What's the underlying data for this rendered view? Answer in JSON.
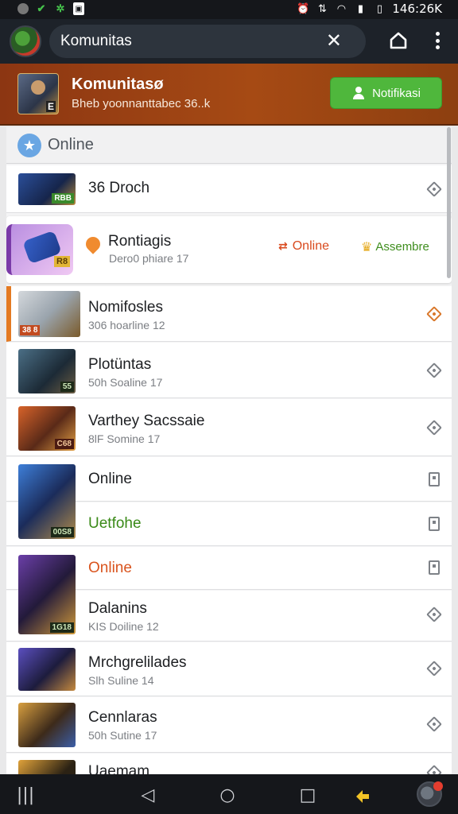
{
  "status_bar": {
    "time": "146:26K"
  },
  "app_bar": {
    "search_value": "Komunitas",
    "clear_glyph": "✕"
  },
  "banner": {
    "title": "Komunitasø",
    "subtitle": "Bheb yoonnanttabec  36..k",
    "thumb_badge": "E",
    "notify_label": "Notifikasi",
    "accent_color": "#4fb73c"
  },
  "section": {
    "title": "Online",
    "icon": "star-icon"
  },
  "rows": {
    "r0": {
      "title": "36 Droch",
      "badge": "RBB"
    },
    "feature": {
      "title": "Rontiagis",
      "subtitle": "Dero0  phiare 17",
      "online_label": "Online",
      "assemble_label": "Assembre"
    },
    "r1": {
      "title": "Nomifosles",
      "meta": "306 hoarline 12",
      "badge": "38 8"
    },
    "r2": {
      "title": "Plotüntas",
      "meta": "50h Soaline 17",
      "badge": "55"
    },
    "r3": {
      "title": "Varthey Sacssaie",
      "meta": "8lF Somine 17",
      "badge": "C68"
    },
    "r4a": {
      "title": "Online"
    },
    "r4b": {
      "title": "Uetfohe"
    },
    "r4c": {
      "title": "Online"
    },
    "r4d": {
      "title": "Dalanins",
      "meta": "KIS Doiline 12",
      "badge": "1G18"
    },
    "r4": {
      "badge": "00S8"
    },
    "r5": {
      "title": "Mrchgrelilades",
      "meta": "Slh Suline 14"
    },
    "r6": {
      "title": "Cennlaras",
      "meta": "50h Sutine 17"
    },
    "r7": {
      "title": "Uaemam"
    }
  },
  "nav": {
    "recent": "|||",
    "back": "◁",
    "home": "○",
    "overview": "□"
  }
}
